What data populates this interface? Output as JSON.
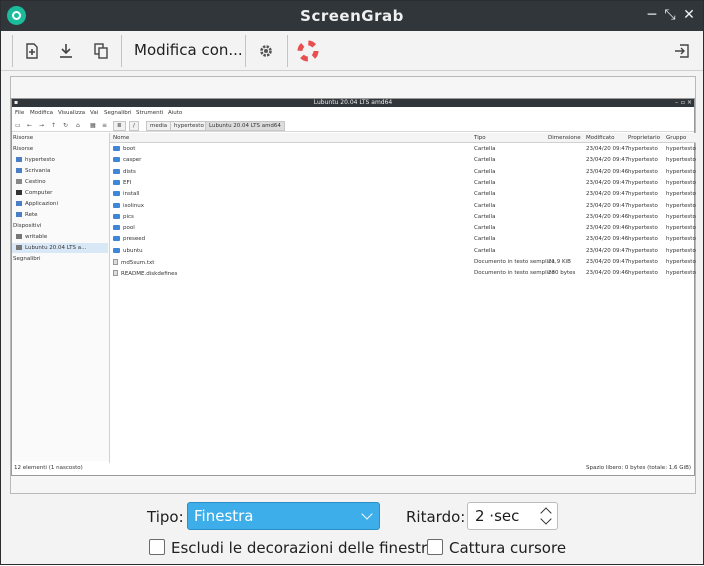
{
  "window": {
    "title": "ScreenGrab",
    "controls": {
      "minimize": "─",
      "maximize": "⤡",
      "close": "✕"
    }
  },
  "toolbar": {
    "label": "Modifica con...",
    "icons": [
      "new-screenshot-icon",
      "save-icon",
      "copy-icon",
      "settings-icon",
      "help-icon",
      "exit-icon"
    ],
    "accent_color": "#e84f4f"
  },
  "preview": {
    "title": "Lubuntu 20.04 LTS amd64",
    "menu": [
      "File",
      "Modifica",
      "Visualizza",
      "Vai",
      "Segnalibri",
      "Strumenti",
      "Aiuto"
    ],
    "crumbs": [
      "/",
      "media",
      "hypertesto",
      "Lubuntu 20.04 LTS amd64"
    ],
    "sidebar": [
      "Risorse",
      "Risorse",
      "hypertesto",
      "Scrivania",
      "Cestino",
      "Computer",
      "Applicazioni",
      "Rete",
      "Dispositivi",
      "writable",
      "Lubuntu 20.04 LTS a...",
      "Segnalibri"
    ],
    "columns": [
      "Nome",
      "Tipo",
      "Dimensione",
      "Modificato",
      "Proprietario",
      "Gruppo"
    ],
    "rows": [
      {
        "name": "boot",
        "type": "Cartella",
        "size": "",
        "modified": "23/04/20 09:47",
        "owner": "hypertesto",
        "group": "hypertesto",
        "kind": "folder"
      },
      {
        "name": "casper",
        "type": "Cartella",
        "size": "",
        "modified": "23/04/20 09:47",
        "owner": "hypertesto",
        "group": "hypertesto",
        "kind": "folder"
      },
      {
        "name": "dists",
        "type": "Cartella",
        "size": "",
        "modified": "23/04/20 09:46",
        "owner": "hypertesto",
        "group": "hypertesto",
        "kind": "folder"
      },
      {
        "name": "EFI",
        "type": "Cartella",
        "size": "",
        "modified": "23/04/20 09:47",
        "owner": "hypertesto",
        "group": "hypertesto",
        "kind": "folder"
      },
      {
        "name": "install",
        "type": "Cartella",
        "size": "",
        "modified": "23/04/20 09:47",
        "owner": "hypertesto",
        "group": "hypertesto",
        "kind": "folder"
      },
      {
        "name": "isolinux",
        "type": "Cartella",
        "size": "",
        "modified": "23/04/20 09:47",
        "owner": "hypertesto",
        "group": "hypertesto",
        "kind": "folder"
      },
      {
        "name": "pics",
        "type": "Cartella",
        "size": "",
        "modified": "23/04/20 09:46",
        "owner": "hypertesto",
        "group": "hypertesto",
        "kind": "folder"
      },
      {
        "name": "pool",
        "type": "Cartella",
        "size": "",
        "modified": "23/04/20 09:46",
        "owner": "hypertesto",
        "group": "hypertesto",
        "kind": "folder"
      },
      {
        "name": "preseed",
        "type": "Cartella",
        "size": "",
        "modified": "23/04/20 09:46",
        "owner": "hypertesto",
        "group": "hypertesto",
        "kind": "folder"
      },
      {
        "name": "ubuntu",
        "type": "Cartella",
        "size": "",
        "modified": "23/04/20 09:47",
        "owner": "hypertesto",
        "group": "hypertesto",
        "kind": "folder"
      },
      {
        "name": "md5sum.txt",
        "type": "Documento in testo semplice",
        "size": "21,9 KiB",
        "modified": "23/04/20 09:47",
        "owner": "hypertesto",
        "group": "hypertesto",
        "kind": "doc"
      },
      {
        "name": "README.diskdefines",
        "type": "Documento in testo semplice",
        "size": "230 bytes",
        "modified": "23/04/20 09:46",
        "owner": "hypertesto",
        "group": "hypertesto",
        "kind": "doc"
      }
    ],
    "status_left": "12 elementi (1 nascosto)",
    "status_right": "Spazio libero: 0 bytes (totale: 1,6 GiB)"
  },
  "options": {
    "type_label": "Tipo:",
    "type_value": "Finestra",
    "delay_label": "Ritardo:",
    "delay_value": "2 ·sec",
    "exclude_decorations": "Escludi le decorazioni delle finestre",
    "capture_cursor": "Cattura cursore",
    "combo_color": "#3daee9"
  }
}
